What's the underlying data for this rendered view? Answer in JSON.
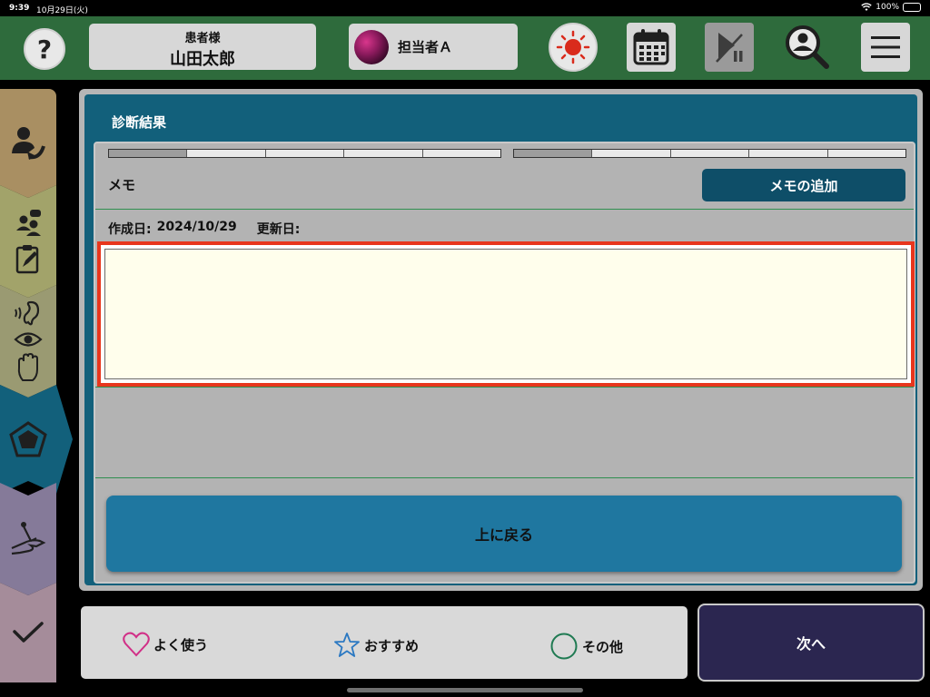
{
  "statusbar": {
    "time": "9:39",
    "date": "10月29日(火)",
    "battery": "100%"
  },
  "header": {
    "patient_label": "患者様",
    "patient_name": "山田太郎",
    "staff_name": "担当者Ａ"
  },
  "icons": {
    "help": "?",
    "light": "sun-icon",
    "calendar": "calendar-icon",
    "playpause": "play-pause-icon",
    "search": "user-search-icon",
    "menu": "menu-icon"
  },
  "sidebar": {
    "tabs": [
      {
        "name": "patient-transfer",
        "color": "#a98f62"
      },
      {
        "name": "interview-checklist",
        "color": "#a2a36a"
      },
      {
        "name": "senses",
        "color": "#9a9a72"
      },
      {
        "name": "diagnosis-pentagon",
        "color": "#12607b",
        "active": true
      },
      {
        "name": "treatment",
        "color": "#857a99"
      },
      {
        "name": "complete",
        "color": "#a58c9a"
      }
    ]
  },
  "main": {
    "section_title": "診断結果",
    "memo_label": "メモ",
    "add_memo_label": "メモの追加",
    "created_label": "作成日:",
    "created_value": "2024/10/29",
    "updated_label": "更新日:",
    "memo_value": "",
    "back_label": "上に戻る"
  },
  "footer": {
    "favorites_label": "よく使う",
    "recommended_label": "おすすめ",
    "other_label": "その他",
    "next_label": "次へ"
  },
  "colors": {
    "header_green": "#2e6b3c",
    "panel_teal": "#12607b",
    "highlight_red": "#e8361d",
    "back_button": "#1f77a0",
    "next_button": "#2b2650"
  }
}
